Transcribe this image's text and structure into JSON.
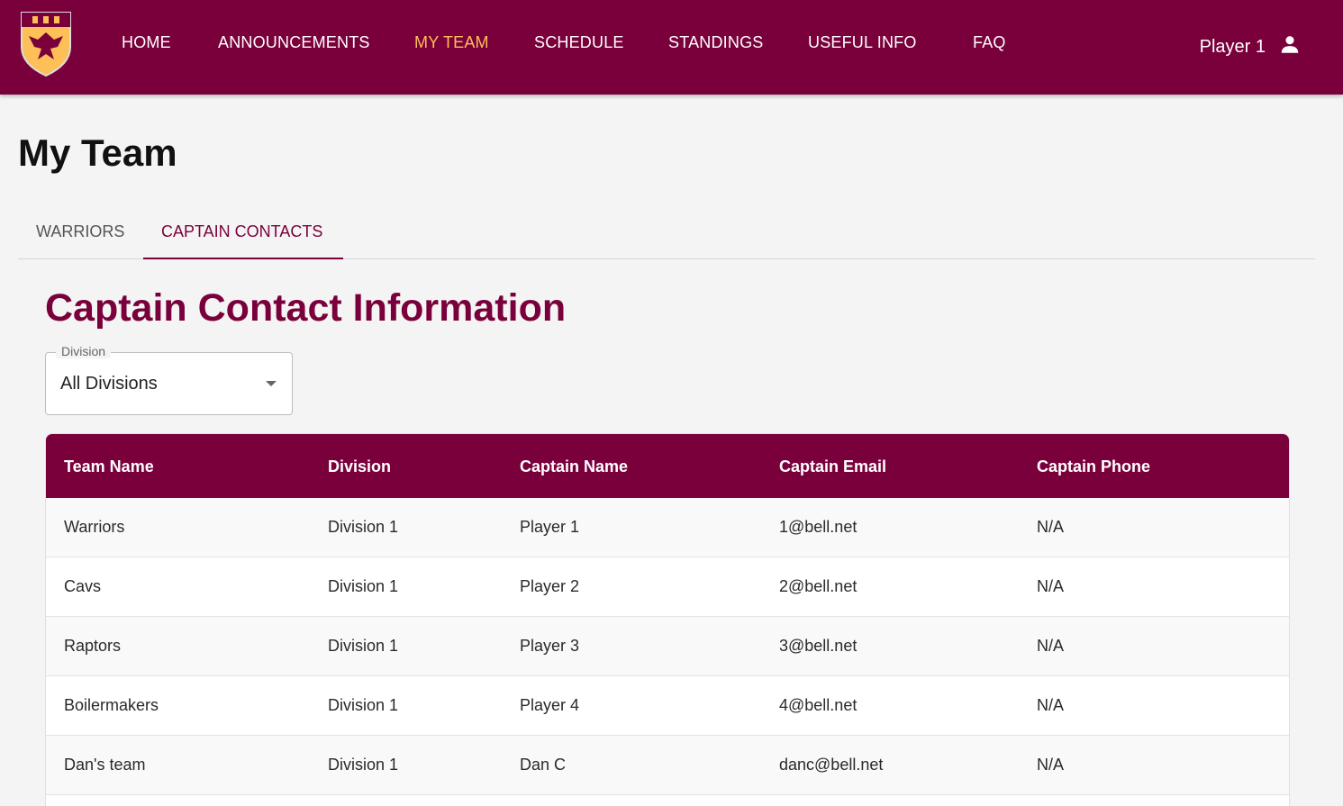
{
  "colors": {
    "brand": "#7a003c",
    "accent": "#fdbf57",
    "background": "#f4f4f4"
  },
  "header": {
    "logo_icon": "crest-logo-icon",
    "nav": [
      {
        "label": "HOME"
      },
      {
        "label": "ANNOUNCEMENTS"
      },
      {
        "label": "MY TEAM",
        "active": true
      },
      {
        "label": "SCHEDULE"
      },
      {
        "label": "STANDINGS"
      },
      {
        "label": "USEFUL INFO"
      },
      {
        "label": "FAQ"
      }
    ],
    "user": {
      "name": "Player 1",
      "icon": "person-icon"
    }
  },
  "page": {
    "title": "My Team"
  },
  "tabs": [
    {
      "label": "WARRIORS"
    },
    {
      "label": "CAPTAIN CONTACTS",
      "active": true
    }
  ],
  "section": {
    "title": "Captain Contact Information"
  },
  "division_select": {
    "label": "Division",
    "value": "All Divisions"
  },
  "table": {
    "columns": [
      "Team Name",
      "Division",
      "Captain Name",
      "Captain Email",
      "Captain Phone"
    ],
    "rows": [
      [
        "Warriors",
        "Division 1",
        "Player 1",
        "1@bell.net",
        "N/A"
      ],
      [
        "Cavs",
        "Division 1",
        "Player 2",
        "2@bell.net",
        "N/A"
      ],
      [
        "Raptors",
        "Division 1",
        "Player 3",
        "3@bell.net",
        "N/A"
      ],
      [
        "Boilermakers",
        "Division 1",
        "Player 4",
        "4@bell.net",
        "N/A"
      ],
      [
        "Dan's team",
        "Division 1",
        "Dan C",
        "danc@bell.net",
        "N/A"
      ]
    ]
  }
}
